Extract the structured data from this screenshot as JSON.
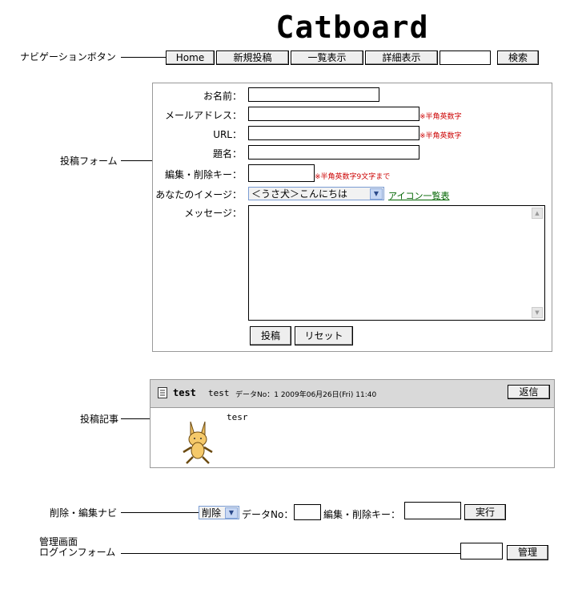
{
  "title": "Catboard",
  "annotations": {
    "nav": "ナビゲーションボタン",
    "form": "投稿フォーム",
    "article": "投稿記事",
    "edit_nav": "削除・編集ナビ",
    "admin_line1": "管理画面",
    "admin_line2": "ログインフォーム"
  },
  "nav": {
    "home": "Home",
    "new_post": "新規投稿",
    "list_view": "一覧表示",
    "detail_view": "詳細表示",
    "search_value": "",
    "search_button": "検索"
  },
  "form": {
    "name_label": "お名前：",
    "email_label": "メールアドレス：",
    "email_note": "※半角英数字",
    "url_label": "URL：",
    "url_note": "※半角英数字",
    "subject_label": "題名：",
    "key_label": "編集・削除キー：",
    "key_note": "※半角英数字9文字まで",
    "image_label": "あなたのイメージ：",
    "image_selected": "＜うさ犬＞こんにちは",
    "icon_list_link": "アイコン一覧表",
    "message_label": "メッセージ：",
    "submit_button": "投稿",
    "reset_button": "リセット"
  },
  "post": {
    "subject": "test",
    "author": "test",
    "meta": "データNo：1 2009年06月26日(Fri) 11:40",
    "reply_button": "返信",
    "body": "tesr"
  },
  "edit_nav": {
    "mode_selected": "削除",
    "data_no_label": "データNo：",
    "data_no_value": "",
    "key_label": "編集・削除キー：",
    "key_value": "",
    "execute_button": "実行"
  },
  "admin": {
    "password_value": "",
    "login_button": "管理"
  }
}
